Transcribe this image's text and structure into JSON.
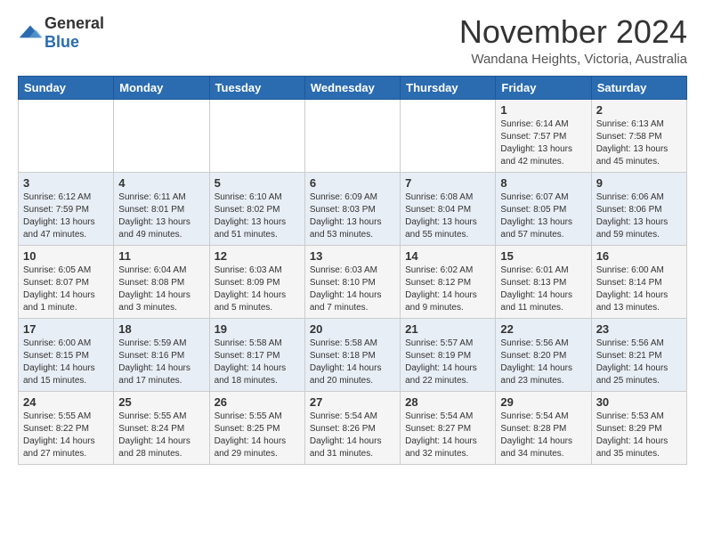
{
  "header": {
    "logo_general": "General",
    "logo_blue": "Blue",
    "month": "November 2024",
    "location": "Wandana Heights, Victoria, Australia"
  },
  "days_of_week": [
    "Sunday",
    "Monday",
    "Tuesday",
    "Wednesday",
    "Thursday",
    "Friday",
    "Saturday"
  ],
  "weeks": [
    [
      {
        "day": "",
        "text": ""
      },
      {
        "day": "",
        "text": ""
      },
      {
        "day": "",
        "text": ""
      },
      {
        "day": "",
        "text": ""
      },
      {
        "day": "",
        "text": ""
      },
      {
        "day": "1",
        "text": "Sunrise: 6:14 AM\nSunset: 7:57 PM\nDaylight: 13 hours\nand 42 minutes."
      },
      {
        "day": "2",
        "text": "Sunrise: 6:13 AM\nSunset: 7:58 PM\nDaylight: 13 hours\nand 45 minutes."
      }
    ],
    [
      {
        "day": "3",
        "text": "Sunrise: 6:12 AM\nSunset: 7:59 PM\nDaylight: 13 hours\nand 47 minutes."
      },
      {
        "day": "4",
        "text": "Sunrise: 6:11 AM\nSunset: 8:01 PM\nDaylight: 13 hours\nand 49 minutes."
      },
      {
        "day": "5",
        "text": "Sunrise: 6:10 AM\nSunset: 8:02 PM\nDaylight: 13 hours\nand 51 minutes."
      },
      {
        "day": "6",
        "text": "Sunrise: 6:09 AM\nSunset: 8:03 PM\nDaylight: 13 hours\nand 53 minutes."
      },
      {
        "day": "7",
        "text": "Sunrise: 6:08 AM\nSunset: 8:04 PM\nDaylight: 13 hours\nand 55 minutes."
      },
      {
        "day": "8",
        "text": "Sunrise: 6:07 AM\nSunset: 8:05 PM\nDaylight: 13 hours\nand 57 minutes."
      },
      {
        "day": "9",
        "text": "Sunrise: 6:06 AM\nSunset: 8:06 PM\nDaylight: 13 hours\nand 59 minutes."
      }
    ],
    [
      {
        "day": "10",
        "text": "Sunrise: 6:05 AM\nSunset: 8:07 PM\nDaylight: 14 hours\nand 1 minute."
      },
      {
        "day": "11",
        "text": "Sunrise: 6:04 AM\nSunset: 8:08 PM\nDaylight: 14 hours\nand 3 minutes."
      },
      {
        "day": "12",
        "text": "Sunrise: 6:03 AM\nSunset: 8:09 PM\nDaylight: 14 hours\nand 5 minutes."
      },
      {
        "day": "13",
        "text": "Sunrise: 6:03 AM\nSunset: 8:10 PM\nDaylight: 14 hours\nand 7 minutes."
      },
      {
        "day": "14",
        "text": "Sunrise: 6:02 AM\nSunset: 8:12 PM\nDaylight: 14 hours\nand 9 minutes."
      },
      {
        "day": "15",
        "text": "Sunrise: 6:01 AM\nSunset: 8:13 PM\nDaylight: 14 hours\nand 11 minutes."
      },
      {
        "day": "16",
        "text": "Sunrise: 6:00 AM\nSunset: 8:14 PM\nDaylight: 14 hours\nand 13 minutes."
      }
    ],
    [
      {
        "day": "17",
        "text": "Sunrise: 6:00 AM\nSunset: 8:15 PM\nDaylight: 14 hours\nand 15 minutes."
      },
      {
        "day": "18",
        "text": "Sunrise: 5:59 AM\nSunset: 8:16 PM\nDaylight: 14 hours\nand 17 minutes."
      },
      {
        "day": "19",
        "text": "Sunrise: 5:58 AM\nSunset: 8:17 PM\nDaylight: 14 hours\nand 18 minutes."
      },
      {
        "day": "20",
        "text": "Sunrise: 5:58 AM\nSunset: 8:18 PM\nDaylight: 14 hours\nand 20 minutes."
      },
      {
        "day": "21",
        "text": "Sunrise: 5:57 AM\nSunset: 8:19 PM\nDaylight: 14 hours\nand 22 minutes."
      },
      {
        "day": "22",
        "text": "Sunrise: 5:56 AM\nSunset: 8:20 PM\nDaylight: 14 hours\nand 23 minutes."
      },
      {
        "day": "23",
        "text": "Sunrise: 5:56 AM\nSunset: 8:21 PM\nDaylight: 14 hours\nand 25 minutes."
      }
    ],
    [
      {
        "day": "24",
        "text": "Sunrise: 5:55 AM\nSunset: 8:22 PM\nDaylight: 14 hours\nand 27 minutes."
      },
      {
        "day": "25",
        "text": "Sunrise: 5:55 AM\nSunset: 8:24 PM\nDaylight: 14 hours\nand 28 minutes."
      },
      {
        "day": "26",
        "text": "Sunrise: 5:55 AM\nSunset: 8:25 PM\nDaylight: 14 hours\nand 29 minutes."
      },
      {
        "day": "27",
        "text": "Sunrise: 5:54 AM\nSunset: 8:26 PM\nDaylight: 14 hours\nand 31 minutes."
      },
      {
        "day": "28",
        "text": "Sunrise: 5:54 AM\nSunset: 8:27 PM\nDaylight: 14 hours\nand 32 minutes."
      },
      {
        "day": "29",
        "text": "Sunrise: 5:54 AM\nSunset: 8:28 PM\nDaylight: 14 hours\nand 34 minutes."
      },
      {
        "day": "30",
        "text": "Sunrise: 5:53 AM\nSunset: 8:29 PM\nDaylight: 14 hours\nand 35 minutes."
      }
    ]
  ]
}
